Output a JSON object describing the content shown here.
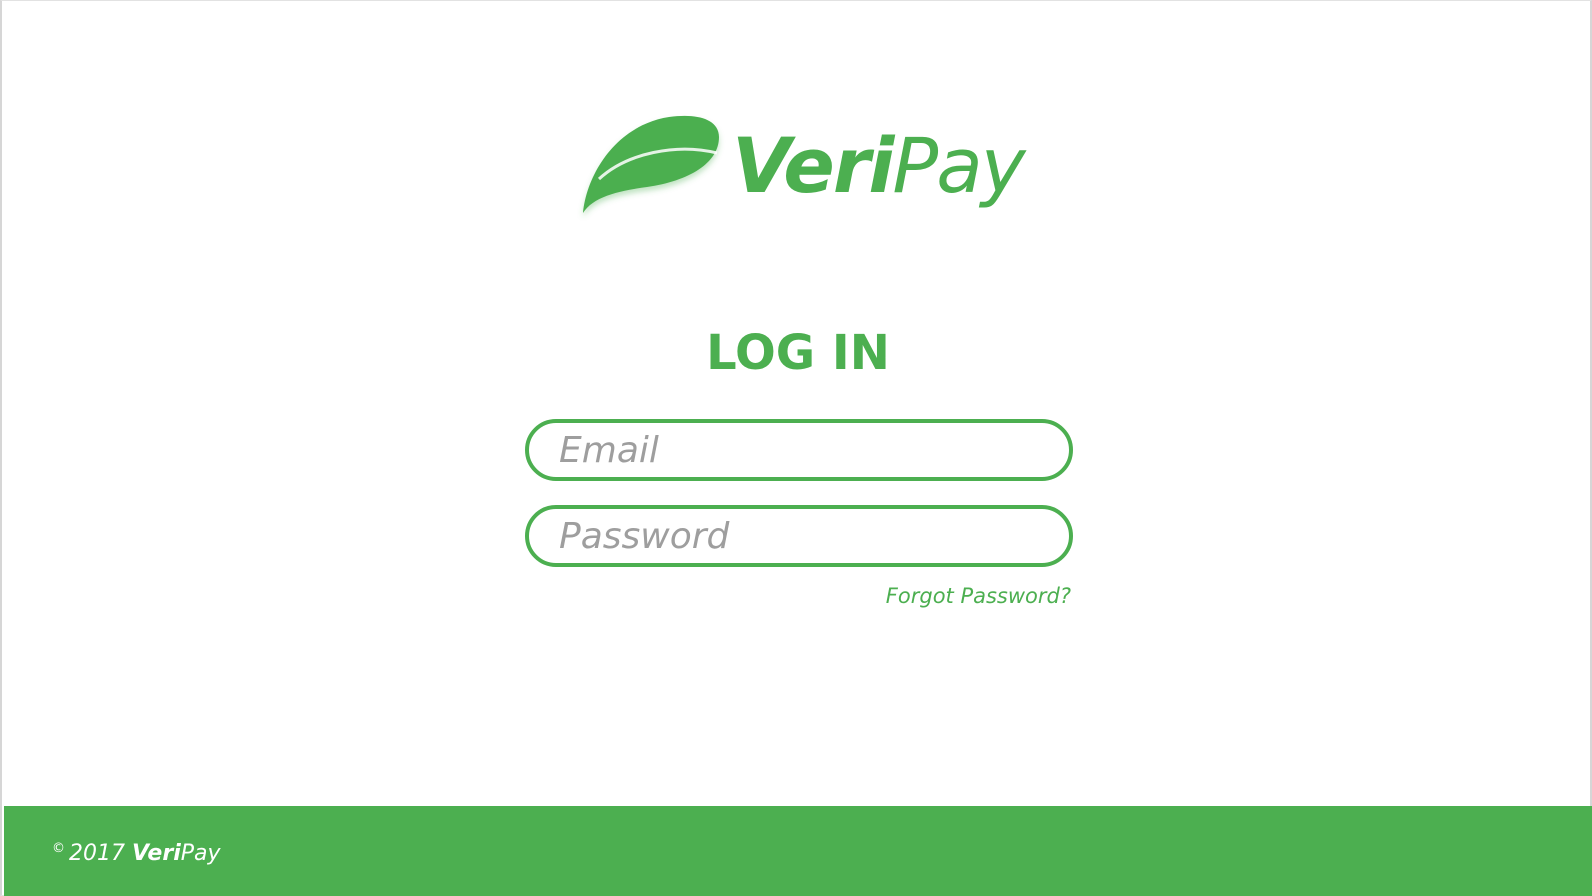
{
  "brand": {
    "name_bold": "Veri",
    "name_light": "Pay",
    "logo_icon": "leaf-icon",
    "color": "#4caf50"
  },
  "login": {
    "title": "LOG IN",
    "email_placeholder": "Email",
    "password_placeholder": "Password",
    "forgot_link": "Forgot Password?"
  },
  "footer": {
    "copyright_symbol": "©",
    "year": "2017",
    "brand_bold": "Veri",
    "brand_light": "Pay",
    "background": "#4caf50"
  }
}
